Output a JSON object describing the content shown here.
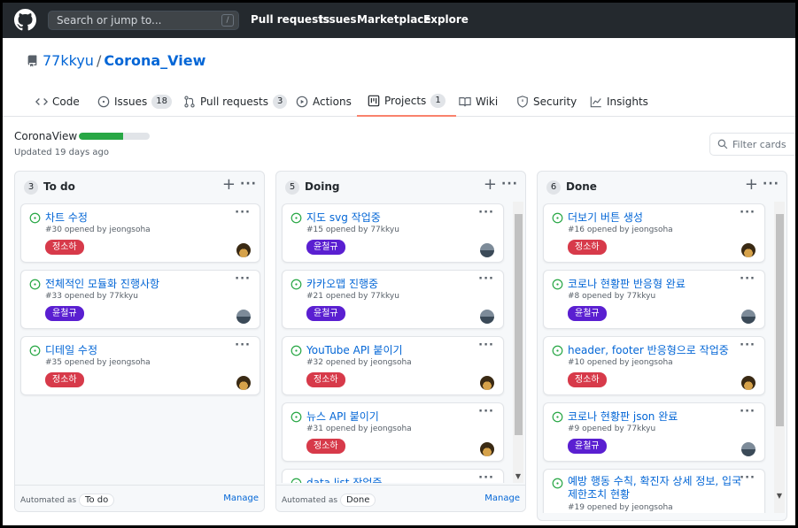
{
  "header": {
    "search_placeholder": "Search or jump to...",
    "search_key": "/",
    "nav": [
      "Pull requests",
      "Issues",
      "Marketplace",
      "Explore"
    ]
  },
  "repo": {
    "owner": "77kkyu",
    "separator": "/",
    "name": "Corona_View"
  },
  "tabs": [
    {
      "label": "Code",
      "icon": "code-icon"
    },
    {
      "label": "Issues",
      "count": "18",
      "icon": "issue-opened-icon"
    },
    {
      "label": "Pull requests",
      "count": "3",
      "icon": "git-pull-request-icon"
    },
    {
      "label": "Actions",
      "icon": "play-icon"
    },
    {
      "label": "Projects",
      "count": "1",
      "icon": "project-icon",
      "active": true
    },
    {
      "label": "Wiki",
      "icon": "book-icon"
    },
    {
      "label": "Security",
      "icon": "shield-icon"
    },
    {
      "label": "Insights",
      "icon": "graph-icon"
    }
  ],
  "project": {
    "name": "CoronaView",
    "progress_percent": 62,
    "updated": "Updated 19 days ago",
    "filter_placeholder": "Filter cards"
  },
  "columns": [
    {
      "count": "3",
      "title": "To do",
      "automated_label": "Automated as",
      "automated_value": "To do",
      "manage": "Manage",
      "cards": [
        {
          "title": "차트 수정",
          "meta": "#30 opened by jeongsoha",
          "label": "정소하",
          "label_color": "#d73a4a",
          "avatar": "dark"
        },
        {
          "title": "전체적인 모듈화 진행사항",
          "meta": "#33 opened by 77kkyu",
          "label": "윤철규",
          "label_color": "#5a1fd1",
          "avatar": "grey"
        },
        {
          "title": "디테일 수정",
          "meta": "#35 opened by jeongsoha",
          "label": "정소하",
          "label_color": "#d73a4a",
          "avatar": "dark"
        }
      ]
    },
    {
      "count": "5",
      "title": "Doing",
      "automated_label": "Automated as",
      "automated_value": "Done",
      "manage": "Manage",
      "cards": [
        {
          "title": "지도 svg 작업중",
          "meta": "#15 opened by 77kkyu",
          "label": "윤철규",
          "label_color": "#5a1fd1",
          "avatar": "grey"
        },
        {
          "title": "카카오맵 진행중",
          "meta": "#21 opened by 77kkyu",
          "label": "윤철규",
          "label_color": "#5a1fd1",
          "avatar": "grey"
        },
        {
          "title": "YouTube API 붙이기",
          "meta": "#32 opened by jeongsoha",
          "label": "정소하",
          "label_color": "#d73a4a",
          "avatar": "dark"
        },
        {
          "title": "뉴스 API 붙이기",
          "meta": "#31 opened by jeongsoha",
          "label": "정소하",
          "label_color": "#d73a4a",
          "avatar": "dark"
        },
        {
          "title": "data list 작업중",
          "meta": "",
          "label": "",
          "label_color": "",
          "avatar": ""
        }
      ]
    },
    {
      "count": "6",
      "title": "Done",
      "automated_label": "",
      "automated_value": "",
      "manage": "",
      "cards": [
        {
          "title": "더보기 버튼 생성",
          "meta": "#16 opened by jeongsoha",
          "label": "정소하",
          "label_color": "#d73a4a",
          "avatar": "dark"
        },
        {
          "title": "코로나 현황판 반응형 완료",
          "meta": "#8 opened by 77kkyu",
          "label": "윤철규",
          "label_color": "#5a1fd1",
          "avatar": "grey"
        },
        {
          "title": "header, footer 반응형으로 작업중",
          "meta": "#10 opened by jeongsoha",
          "label": "정소하",
          "label_color": "#d73a4a",
          "avatar": "dark"
        },
        {
          "title": "코로나 현황판 json 완료",
          "meta": "#9 opened by 77kkyu",
          "label": "윤철규",
          "label_color": "#5a1fd1",
          "avatar": "grey"
        },
        {
          "title": "예방 행동 수칙, 확진자 상세 정보, 입국 제한조치 현황",
          "meta": "#19 opened by jeongsoha",
          "label": "",
          "label_color": "",
          "avatar": ""
        }
      ]
    }
  ],
  "colors": {
    "header_bg": "#24292e",
    "link": "#0366d6",
    "open_issue": "#28a745",
    "active_tab": "#f9826c",
    "progress": "#28a745"
  }
}
